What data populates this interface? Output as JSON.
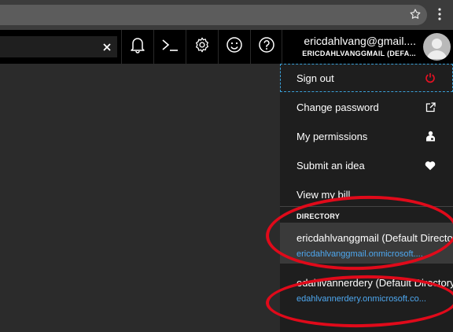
{
  "topbar": {
    "account_email": "ericdahlvang@gmail....",
    "account_directory": "ERICDAHLVANGGMAIL (DEFA..."
  },
  "menu": {
    "items": [
      {
        "label": "Sign out",
        "icon": "power-icon"
      },
      {
        "label": "Change password",
        "icon": "external-link-icon"
      },
      {
        "label": "My permissions",
        "icon": "person-badge-icon"
      },
      {
        "label": "Submit an idea",
        "icon": "heart-icon"
      },
      {
        "label": "View my bill",
        "icon": ""
      }
    ],
    "directory_header": "DIRECTORY",
    "directories": [
      {
        "name": "ericdahlvanggmail (Default Directo",
        "domain": "ericdahlvanggmail.onmicrosoft...."
      },
      {
        "name": "edahlvannerdery (Default Directory",
        "domain": "edahlvannerdery.onmicrosoft.co..."
      }
    ]
  },
  "colors": {
    "power_icon": "#e81123",
    "link_text": "#4ea8f0",
    "annotation": "#e00a1a",
    "focus_outline": "#3aa0d8"
  }
}
